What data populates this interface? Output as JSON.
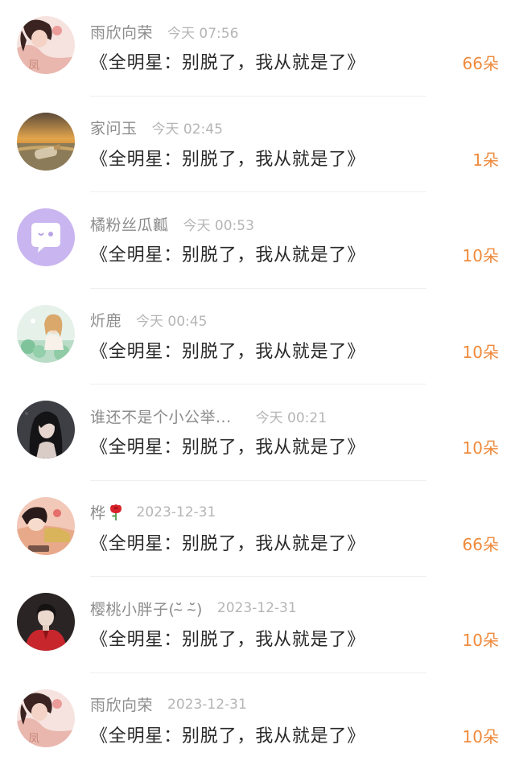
{
  "accent_color": "#ef8a3c",
  "items": [
    {
      "name": "雨欣向荣",
      "time": "今天 07:56",
      "title": "《全明星：别脱了，我从就是了》",
      "count": "66朵",
      "avatar": "avatar-girl-pink"
    },
    {
      "name": "家问玉",
      "time": "今天 02:45",
      "title": "《全明星：别脱了，我从就是了》",
      "count": "1朵",
      "avatar": "avatar-beach-bottle"
    },
    {
      "name": "橘粉丝瓜瓤",
      "time": "今天 00:53",
      "title": "《全明星：别脱了，我从就是了》",
      "count": "10朵",
      "avatar": "avatar-purple-chat"
    },
    {
      "name": "炘鹿",
      "time": "今天 00:45",
      "title": "《全明星：别脱了，我从就是了》",
      "count": "10朵",
      "avatar": "avatar-illustrated-girl"
    },
    {
      "name": "谁还不是个小公举...",
      "time": "今天 00:21",
      "title": "《全明星：别脱了，我从就是了》",
      "count": "10朵",
      "avatar": "avatar-dark-girl"
    },
    {
      "name": "桦",
      "time": "2023-12-31",
      "title": "《全明星：别脱了，我从就是了》",
      "count": "66朵",
      "avatar": "avatar-sleeping-girl",
      "emoji": "rose-icon"
    },
    {
      "name": "樱桃小胖子(˘̴̆ ˘̴̆)",
      "time": "2023-12-31",
      "title": "《全明星：别脱了，我从就是了》",
      "count": "10朵",
      "avatar": "avatar-boy-red"
    },
    {
      "name": "雨欣向荣",
      "time": "2023-12-31",
      "title": "《全明星：别脱了，我从就是了》",
      "count": "10朵",
      "avatar": "avatar-girl-pink"
    }
  ]
}
